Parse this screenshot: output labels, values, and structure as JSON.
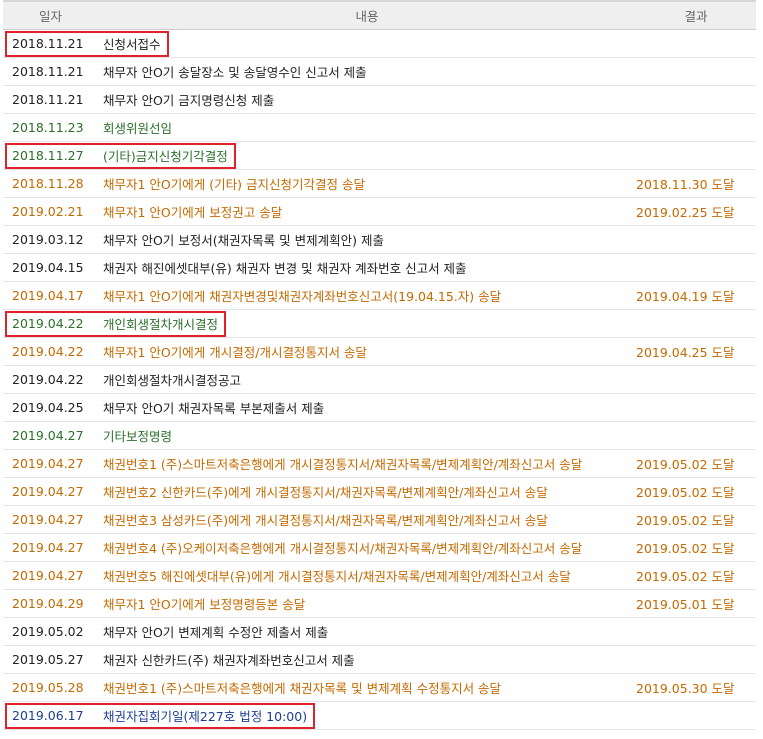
{
  "header": {
    "date": "일자",
    "content": "내용",
    "result": "결과"
  },
  "colors": {
    "black": "#222222",
    "orange": "#c46a00",
    "green": "#2b6f2b",
    "blue": "#1c3f93",
    "highlight": "#e0202a"
  },
  "rows": [
    {
      "date": "2018.11.21",
      "content": "신청서접수",
      "result": "",
      "color": "black",
      "highlighted": true
    },
    {
      "date": "2018.11.21",
      "content": "채무자 안O기 송달장소 및 송달영수인 신고서 제출",
      "result": "",
      "color": "black",
      "highlighted": false
    },
    {
      "date": "2018.11.21",
      "content": "채무자 안O기 금지명령신청 제출",
      "result": "",
      "color": "black",
      "highlighted": false
    },
    {
      "date": "2018.11.23",
      "content": "회생위원선임",
      "result": "",
      "color": "green",
      "highlighted": false
    },
    {
      "date": "2018.11.27",
      "content": "(기타)금지신청기각결정",
      "result": "",
      "color": "green",
      "highlighted": true
    },
    {
      "date": "2018.11.28",
      "content": "채무자1 안O기에게 (기타) 금지신청기각결정 송달",
      "result": "2018.11.30 도달",
      "color": "orange",
      "highlighted": false
    },
    {
      "date": "2019.02.21",
      "content": "채무자1 안O기에게 보정권고 송달",
      "result": "2019.02.25 도달",
      "color": "orange",
      "highlighted": false
    },
    {
      "date": "2019.03.12",
      "content": "채무자 안O기 보정서(채권자목록 및 변제계획안) 제출",
      "result": "",
      "color": "black",
      "highlighted": false
    },
    {
      "date": "2019.04.15",
      "content": "채권자 해진에셋대부(유) 채권자 변경 및 채권자 계좌번호 신고서 제출",
      "result": "",
      "color": "black",
      "highlighted": false
    },
    {
      "date": "2019.04.17",
      "content": "채무자1 안O기에게 채권자변경및채권자계좌번호신고서(19.04.15.자) 송달",
      "result": "2019.04.19 도달",
      "color": "orange",
      "highlighted": false
    },
    {
      "date": "2019.04.22",
      "content": "개인회생절차개시결정",
      "result": "",
      "color": "green",
      "highlighted": true
    },
    {
      "date": "2019.04.22",
      "content": "채무자1 안O기에게 개시결정/개시결정통지서 송달",
      "result": "2019.04.25 도달",
      "color": "orange",
      "highlighted": false
    },
    {
      "date": "2019.04.22",
      "content": "개인회생절차개시결정공고",
      "result": "",
      "color": "black",
      "highlighted": false
    },
    {
      "date": "2019.04.25",
      "content": "채무자 안O기 채권자목록 부본제출서 제출",
      "result": "",
      "color": "black",
      "highlighted": false
    },
    {
      "date": "2019.04.27",
      "content": "기타보정명령",
      "result": "",
      "color": "green",
      "highlighted": false
    },
    {
      "date": "2019.04.27",
      "content": "채권번호1 (주)스마트저축은행에게 개시결정통지서/채권자목록/변제계획안/계좌신고서 송달",
      "result": "2019.05.02 도달",
      "color": "orange",
      "highlighted": false
    },
    {
      "date": "2019.04.27",
      "content": "채권번호2 신한카드(주)에게 개시결정통지서/채권자목록/변제계획안/계좌신고서 송달",
      "result": "2019.05.02 도달",
      "color": "orange",
      "highlighted": false
    },
    {
      "date": "2019.04.27",
      "content": "채권번호3 삼성카드(주)에게 개시결정통지서/채권자목록/변제계획안/계좌신고서 송달",
      "result": "2019.05.02 도달",
      "color": "orange",
      "highlighted": false
    },
    {
      "date": "2019.04.27",
      "content": "채권번호4 (주)오케이저축은행에게 개시결정통지서/채권자목록/변제계획안/계좌신고서 송달",
      "result": "2019.05.02 도달",
      "color": "orange",
      "highlighted": false
    },
    {
      "date": "2019.04.27",
      "content": "채권번호5 해진에셋대부(유)에게 개시결정통지서/채권자목록/변제계획안/계좌신고서 송달",
      "result": "2019.05.02 도달",
      "color": "orange",
      "highlighted": false
    },
    {
      "date": "2019.04.29",
      "content": "채무자1 안O기에게 보정명령등본 송달",
      "result": "2019.05.01 도달",
      "color": "orange",
      "highlighted": false
    },
    {
      "date": "2019.05.02",
      "content": "채무자 안O기 변제계획 수정안 제출서 제출",
      "result": "",
      "color": "black",
      "highlighted": false
    },
    {
      "date": "2019.05.27",
      "content": "채권자 신한카드(주) 채권자계좌번호신고서 제출",
      "result": "",
      "color": "black",
      "highlighted": false
    },
    {
      "date": "2019.05.28",
      "content": "채권번호1 (주)스마트저축은행에게 채권자목록 및 변제계획 수정통지서 송달",
      "result": "2019.05.30 도달",
      "color": "orange",
      "highlighted": false
    },
    {
      "date": "2019.06.17",
      "content": "채권자집회기일(제227호 법정 10:00)",
      "result": "",
      "color": "blue",
      "highlighted": true
    }
  ]
}
